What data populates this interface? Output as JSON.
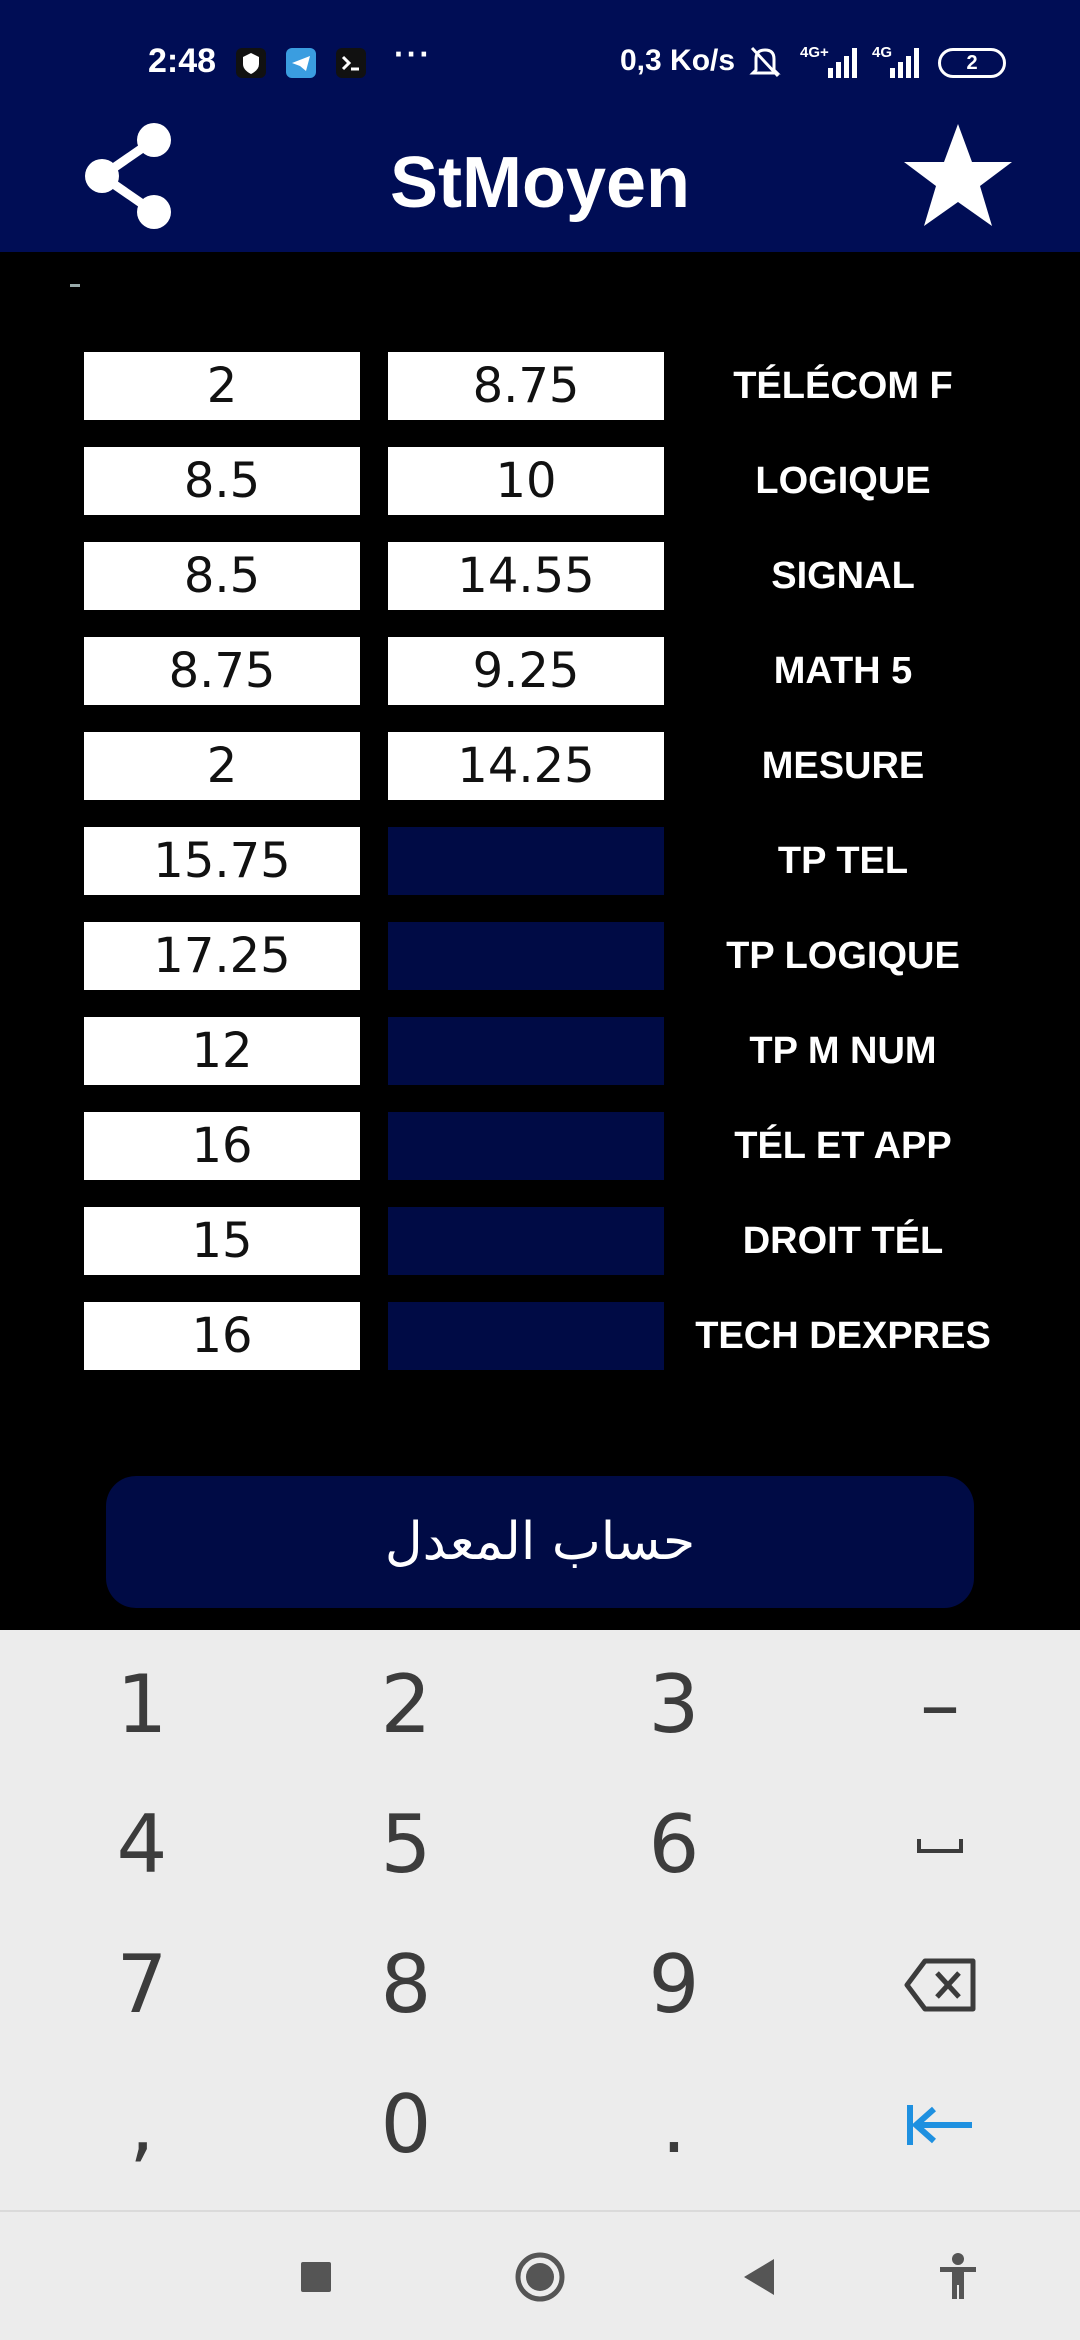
{
  "status_bar": {
    "time": "2:48",
    "dots": "···",
    "net_speed": "0,3 Ko/s",
    "net_type_1": "4G+",
    "net_type_2": "4G",
    "battery": "2"
  },
  "app_bar": {
    "title": "StMoyen",
    "share_icon": "share-icon",
    "star_icon": "star-icon"
  },
  "colors": {
    "primary": "#000d55",
    "empty_cell": "#000b45",
    "keyboard_bg": "#ececec",
    "enter_key": "#1e90e0"
  },
  "grades": [
    {
      "subject": "TÉLÉCOM F",
      "col1": "2",
      "col2": "8.75"
    },
    {
      "subject": "LOGIQUE",
      "col1": "8.5",
      "col2": "10"
    },
    {
      "subject": "SIGNAL",
      "col1": "8.5",
      "col2": "14.55"
    },
    {
      "subject": "MATH 5",
      "col1": "8.75",
      "col2": "9.25"
    },
    {
      "subject": "MESURE",
      "col1": "2",
      "col2": "14.25"
    },
    {
      "subject": "TP TEL",
      "col1": "15.75",
      "col2": ""
    },
    {
      "subject": "TP LOGIQUE",
      "col1": "17.25",
      "col2": ""
    },
    {
      "subject": "TP M NUM",
      "col1": "12",
      "col2": ""
    },
    {
      "subject": "TÉL ET APP",
      "col1": "16",
      "col2": ""
    },
    {
      "subject": "DROIT TÉL",
      "col1": "15",
      "col2": ""
    },
    {
      "subject": "TECH DEXPRES",
      "col1": "16",
      "col2": ""
    }
  ],
  "calculate_button": "حساب المعدل",
  "keyboard": {
    "keys": [
      "1",
      "2",
      "3",
      "–",
      "4",
      "5",
      "6",
      "space",
      "7",
      "8",
      "9",
      "backspace",
      ",",
      "0",
      ".",
      "enter"
    ]
  },
  "nav": {
    "recents_icon": "square-icon",
    "home_icon": "circle-icon",
    "back_icon": "triangle-back-icon",
    "accessibility_icon": "accessibility-icon"
  }
}
